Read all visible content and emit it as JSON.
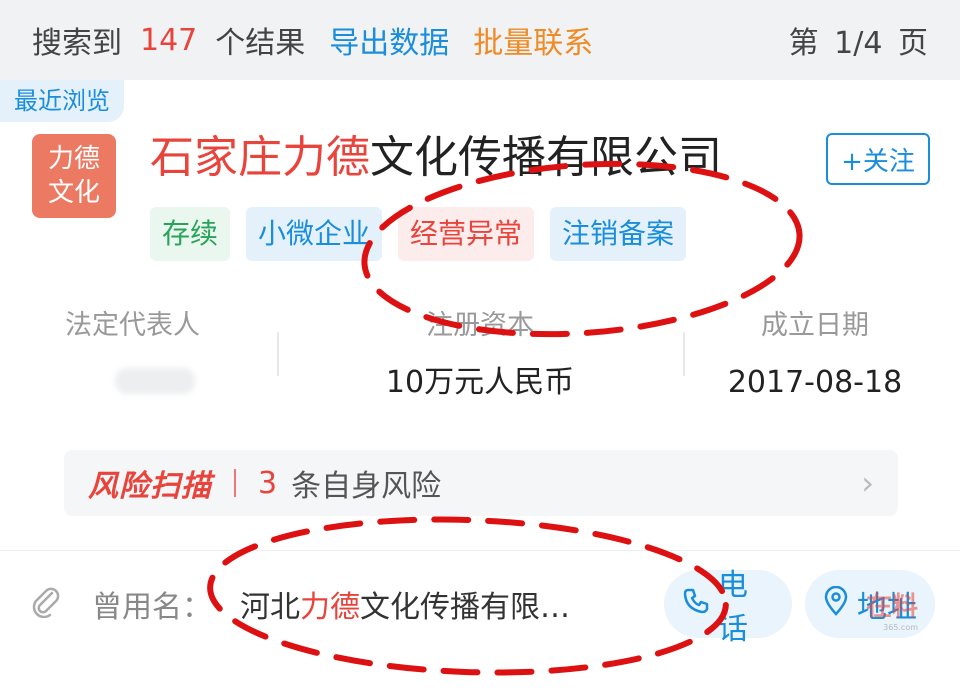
{
  "header": {
    "found_prefix": "搜索到",
    "count": "147",
    "found_suffix": "个结果",
    "export_label": "导出数据",
    "batch_label": "批量联系",
    "pagination": "第 1/4 页"
  },
  "recent_badge": "最近浏览",
  "company": {
    "logo_line1": "力德",
    "logo_line2": "文化",
    "name_prefix": "石家庄力德",
    "name_rest": "文化传播有限公司",
    "follow_label": "+关注",
    "tags": [
      {
        "label": "存续",
        "color": "green"
      },
      {
        "label": "小微企业",
        "color": "blue"
      },
      {
        "label": "经营异常",
        "color": "red"
      },
      {
        "label": "注销备案",
        "color": "blue"
      }
    ]
  },
  "info": {
    "legal_rep_label": "法定代表人",
    "capital_label": "注册资本",
    "capital_value": "10万元人民币",
    "founded_label": "成立日期",
    "founded_value": "2017-08-18"
  },
  "risk": {
    "brand": "风险扫描",
    "count": "3",
    "text": "条自身风险",
    "chevron": "›"
  },
  "former_name": {
    "label": "曾用名：",
    "prefix": "河北",
    "highlight": "力德",
    "rest": "文化传播有限…",
    "phone_label": "电话",
    "address_label": "地址"
  },
  "watermark": {
    "text": "在料",
    "sub": "365.com"
  },
  "icons": [
    "paperclip-icon",
    "phone-icon",
    "location-pin-icon",
    "chevron-right-icon"
  ],
  "colors": {
    "accent": "#1a8ddb",
    "highlight": "#e8443c",
    "orange": "#f08a24",
    "logo_bg": "#ec7a63",
    "annotation": "#dd1111"
  }
}
